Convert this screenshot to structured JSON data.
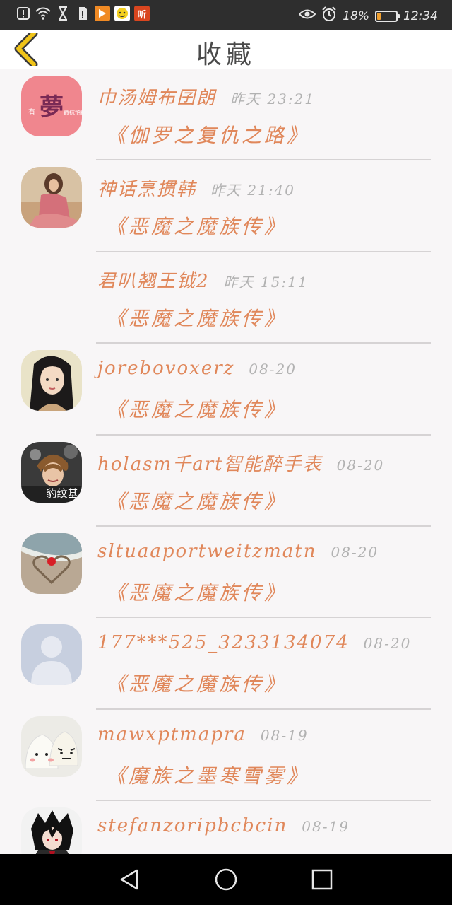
{
  "status_bar": {
    "battery_percent": "18%",
    "battery_level": 0.18,
    "time": "12:34",
    "icons": [
      "alert-icon",
      "wifi-icon",
      "hourglass-icon",
      "sim-icon",
      "video-app-icon",
      "chat-app-icon",
      "listen-app-icon",
      "eye-icon",
      "alarm-icon",
      "battery-icon"
    ],
    "listen_app_label": "听",
    "colors": {
      "video_app": "#f08a24",
      "chat_app": "#f4d020",
      "listen_app": "#d9461f"
    }
  },
  "header": {
    "title": "收藏",
    "back_icon": "chevron-left-icon",
    "back_color": "#f0c419"
  },
  "colors": {
    "accent": "#e0875a",
    "muted": "#b2b2b2"
  },
  "favorites": [
    {
      "user": "巾汤姆布囝朗",
      "time": "昨天 23:21",
      "book": "《伽罗之复仇之路》",
      "avatar": "pink-logo-avatar",
      "avatar_text": "夢",
      "avatar_small_left": "有",
      "avatar_small_right": "戳抗怕痛"
    },
    {
      "user": "神话烹掼韩",
      "time": "昨天 21:40",
      "book": "《恶魔之魔族传》",
      "avatar": "girl-on-beach-avatar"
    },
    {
      "user": "君叭翘王钺2",
      "time": "昨天 15:11",
      "book": "《恶魔之魔族传》",
      "avatar": "none"
    },
    {
      "user": "jorebovoxerz",
      "time": "08-20",
      "book": "《恶魔之魔族传》",
      "avatar": "anime-girl-avatar"
    },
    {
      "user": "holasm千art智能醉手表",
      "time": "08-20",
      "book": "《恶魔之魔族传》",
      "avatar": "boy-photo-avatar",
      "avatar_text": "豹纹基"
    },
    {
      "user": "sltuaaportweitzmatn",
      "time": "08-20",
      "book": "《恶魔之魔族传》",
      "avatar": "sand-heart-avatar"
    },
    {
      "user": "177***525_3233134074",
      "time": "08-20",
      "book": "《恶魔之魔族传》",
      "avatar": "default-person-avatar"
    },
    {
      "user": "mawxptmapra",
      "time": "08-19",
      "book": "《魔族之墨寒雪雾》",
      "avatar": "rice-dumplings-avatar"
    },
    {
      "user": "stefanzoripbcbcin",
      "time": "08-19",
      "book": "",
      "avatar": "anime-boy-avatar"
    }
  ],
  "nav_bar": {
    "buttons": [
      "back-triangle-icon",
      "home-circle-icon",
      "recents-square-icon"
    ]
  }
}
